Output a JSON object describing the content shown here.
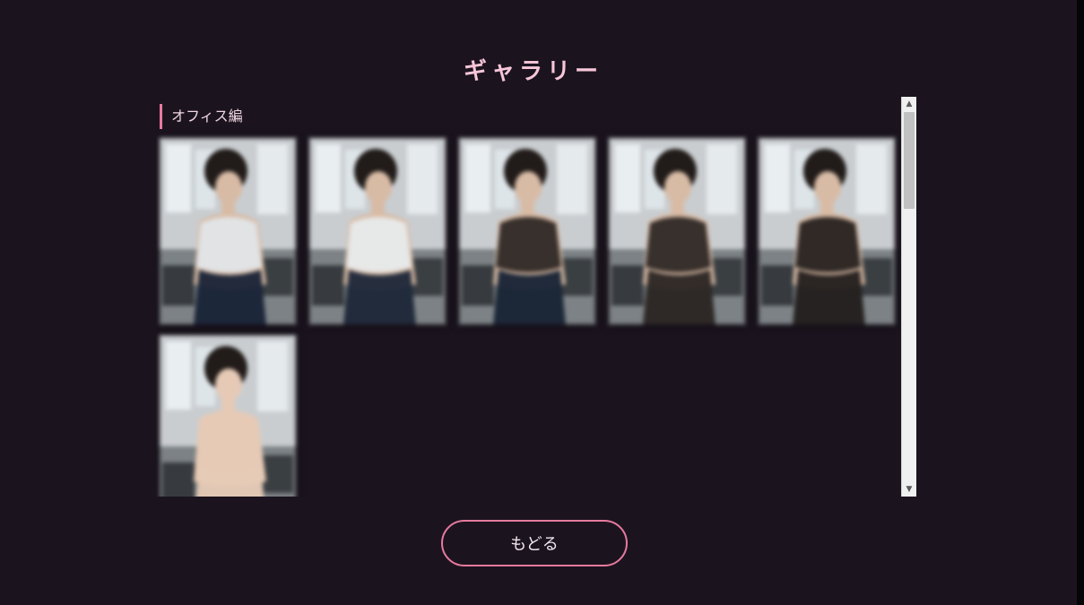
{
  "title": "ギャラリー",
  "section": {
    "label": "オフィス編"
  },
  "gallery": {
    "items": [
      {
        "name": "office-01",
        "outfit_color": "#e2e6ea",
        "lower_color": "#182236",
        "skin_color": "#d8bba5"
      },
      {
        "name": "office-02",
        "outfit_color": "#e8ebee",
        "lower_color": "#1c2638",
        "skin_color": "#d8bba5"
      },
      {
        "name": "office-03",
        "outfit_color": "#2a2422",
        "lower_color": "#172234",
        "skin_color": "#d8bba5"
      },
      {
        "name": "office-04",
        "outfit_color": "#2a2422",
        "lower_color": "#2a2422",
        "skin_color": "#d8bba5"
      },
      {
        "name": "office-05",
        "outfit_color": "#221c1b",
        "lower_color": "#221c1b",
        "skin_color": "#d8bba5"
      },
      {
        "name": "office-06",
        "outfit_color": "#e6cab6",
        "lower_color": "#e6cab6",
        "skin_color": "#e6cab6"
      }
    ]
  },
  "scrollbar": {
    "up_icon": "▲",
    "down_icon": "▼"
  },
  "buttons": {
    "back": "もどる"
  },
  "colors": {
    "background": "#1b141f",
    "accent": "#e77a9e",
    "title": "#f7c6d8"
  }
}
